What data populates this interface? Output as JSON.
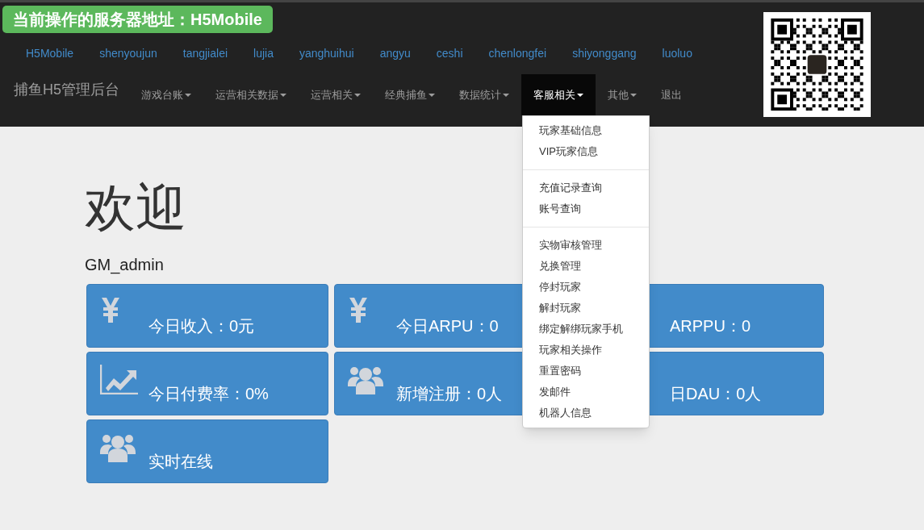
{
  "server_badge": "当前操作的服务器地址：H5Mobile",
  "server_links": [
    "H5Mobile",
    "shenyoujun",
    "tangjialei",
    "lujia",
    "yanghuihui",
    "angyu",
    "ceshi",
    "chenlongfei",
    "shiyonggang",
    "luoluo"
  ],
  "brand": "捕鱼H5管理后台",
  "nav": [
    {
      "label": "游戏台账",
      "caret": true,
      "selected": false
    },
    {
      "label": "运营相关数据",
      "caret": true,
      "selected": false
    },
    {
      "label": "运营相关",
      "caret": true,
      "selected": false
    },
    {
      "label": "经典捕鱼",
      "caret": true,
      "selected": false
    },
    {
      "label": "数据统计",
      "caret": true,
      "selected": false
    },
    {
      "label": "客服相关",
      "caret": true,
      "selected": true,
      "expanded": true,
      "menu": [
        [
          "玩家基础信息",
          "VIP玩家信息"
        ],
        [
          "充值记录查询",
          "账号查询"
        ],
        [
          "实物审核管理",
          "兑换管理",
          "停封玩家",
          "解封玩家",
          "绑定解绑玩家手机",
          "玩家相关操作",
          "重置密码",
          "发邮件",
          "机器人信息"
        ]
      ]
    },
    {
      "label": "其他",
      "caret": true,
      "selected": false
    },
    {
      "label": "退出",
      "caret": false,
      "selected": false
    }
  ],
  "welcome": {
    "title": "欢迎",
    "user": "GM_admin"
  },
  "cards": [
    {
      "kind": "yen",
      "label": "今日收入：0元"
    },
    {
      "kind": "yen",
      "label": "今日ARPU：0"
    },
    {
      "kind": "covered",
      "label": "ARPPU：0"
    },
    {
      "kind": "chart",
      "label": "今日付费率：0%"
    },
    {
      "kind": "users",
      "label": "新增注册：0人"
    },
    {
      "kind": "covered",
      "label": "日DAU：0人"
    },
    {
      "kind": "users",
      "label": "实时在线"
    }
  ]
}
